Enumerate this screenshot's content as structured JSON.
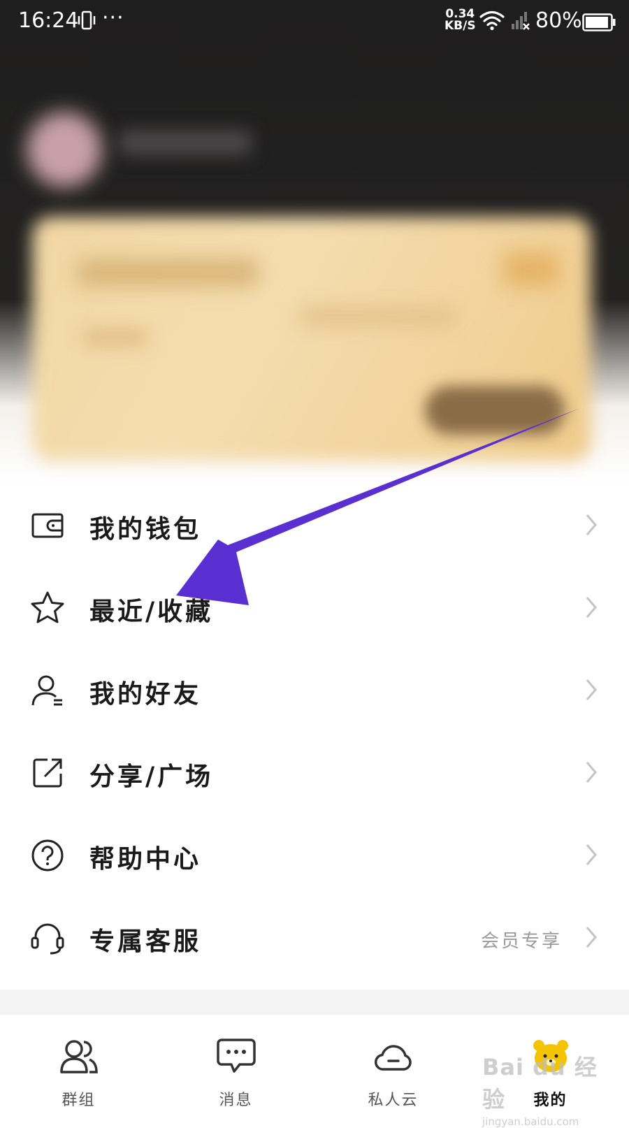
{
  "status_bar": {
    "time": "16:24",
    "dots": "···",
    "speed_value": "0.34",
    "speed_unit": "KB/S",
    "battery": "80%"
  },
  "menu": [
    {
      "label": "我的钱包",
      "icon": "wallet-icon"
    },
    {
      "label": "最近/收藏",
      "icon": "star-icon"
    },
    {
      "label": "我的好友",
      "icon": "person-icon"
    },
    {
      "label": "分享/广场",
      "icon": "share-icon"
    },
    {
      "label": "帮助中心",
      "icon": "help-icon"
    },
    {
      "label": "专属客服",
      "icon": "headset-icon",
      "extra": "会员专享"
    }
  ],
  "tabs": [
    {
      "label": "群组",
      "icon": "group-icon"
    },
    {
      "label": "消息",
      "icon": "message-icon"
    },
    {
      "label": "私人云",
      "icon": "cloud-icon"
    },
    {
      "label": "我的",
      "icon": "bear-icon",
      "active": true
    }
  ],
  "watermark": {
    "brand": "Bai du 经验",
    "url": "jingyan.baidu.com"
  },
  "colors": {
    "arrow": "#5a2fd1",
    "header_dark": "#1f1e1e",
    "card_gold": "#f2d7a3",
    "tab_bear": "#f5c400"
  }
}
